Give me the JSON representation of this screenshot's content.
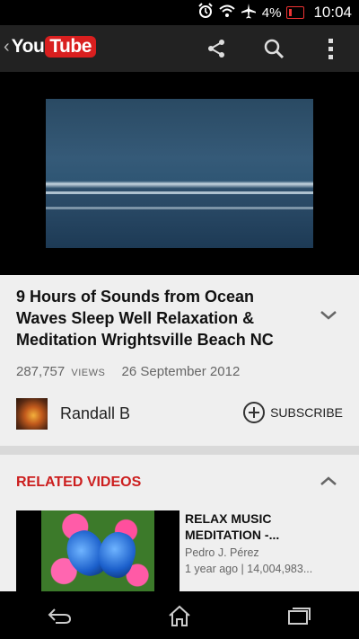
{
  "status_bar": {
    "battery_percent": "4%",
    "time": "10:04",
    "icons": [
      "alarm-icon",
      "wifi-icon",
      "airplane-icon",
      "battery-icon"
    ]
  },
  "app_bar": {
    "logo_you": "You",
    "logo_tube": "Tube",
    "actions": [
      "share-icon",
      "search-icon",
      "overflow-menu-icon"
    ]
  },
  "video": {
    "title": "9 Hours of Sounds from Ocean Waves Sleep Well Relaxation & Meditation Wrightsville Beach NC",
    "views": "287,757",
    "views_label": "VIEWS",
    "date": "26 September 2012",
    "channel_name": "Randall B",
    "subscribe_label": "SUBSCRIBE"
  },
  "related": {
    "header": "RELATED VIDEOS",
    "items": [
      {
        "title": "RELAX MUSIC MEDITATION -...",
        "author": "Pedro J. Pérez",
        "stats": "1 year ago | 14,004,983..."
      }
    ]
  },
  "nav_bar": {
    "buttons": [
      "back-icon",
      "home-icon",
      "recents-icon"
    ]
  },
  "colors": {
    "accent_red": "#cc1e1e",
    "app_bar_bg": "#222222",
    "content_bg": "#efefef"
  }
}
